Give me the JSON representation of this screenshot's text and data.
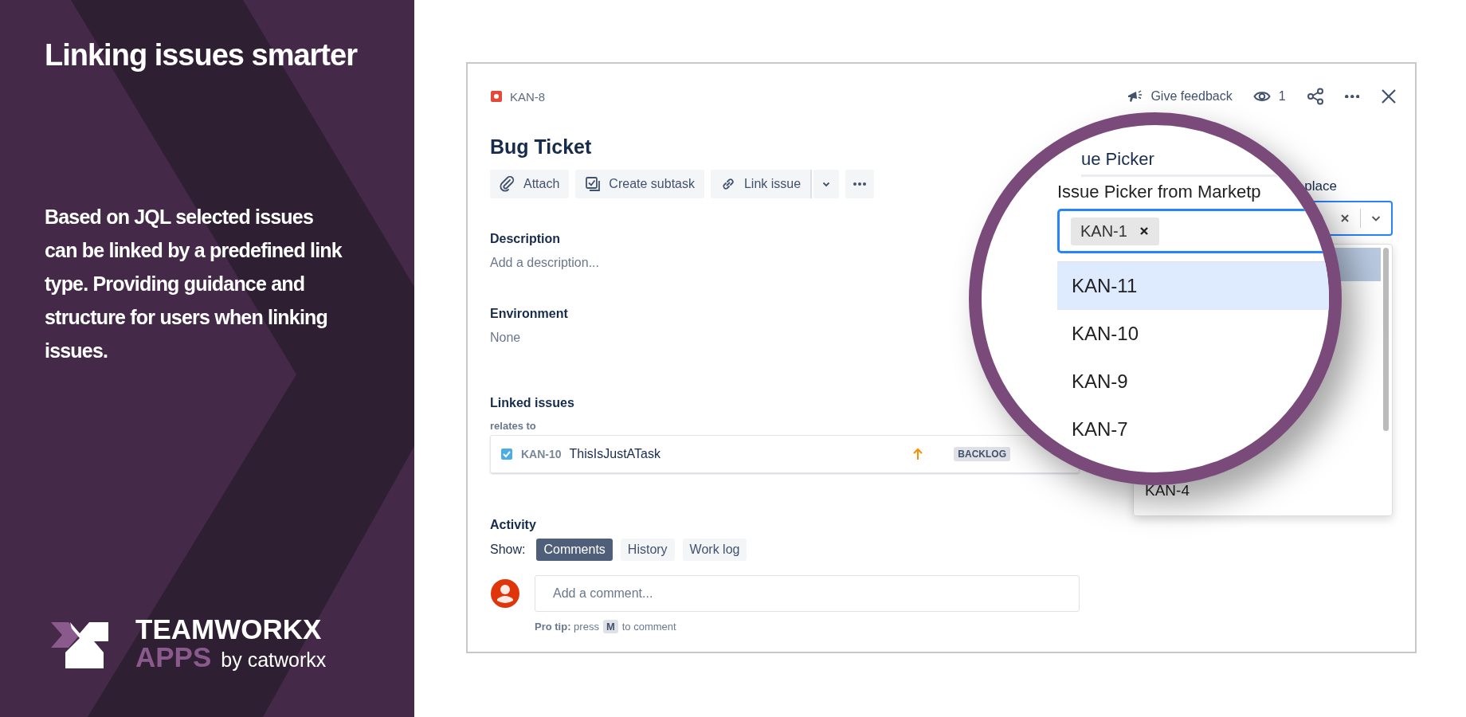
{
  "promo": {
    "title": "Linking issues smarter",
    "description": "Based on JQL selected issues can be linked by a predefined link type. Providing guidance and structure for users when linking issues.",
    "logo": {
      "brand": "TEAMWORKX",
      "apps": "APPS",
      "by": "by catworkx"
    }
  },
  "issue": {
    "key": "KAN-8",
    "header_actions": [
      {
        "kind": "feedback",
        "label": "Give feedback"
      },
      {
        "kind": "watch",
        "label": "1"
      },
      {
        "kind": "share"
      },
      {
        "kind": "more"
      },
      {
        "kind": "close"
      }
    ],
    "title": "Bug Ticket",
    "toolbar": [
      {
        "kind": "attach",
        "label": "Attach"
      },
      {
        "kind": "subtask",
        "label": "Create subtask"
      },
      {
        "kind": "link",
        "label": "Link issue"
      },
      {
        "kind": "dropdown"
      },
      {
        "kind": "more"
      }
    ],
    "fields": [
      {
        "label": "Description",
        "value": "Add a description..."
      },
      {
        "label": "Environment",
        "value": "None"
      }
    ],
    "linked_issues": {
      "title": "Linked issues",
      "relation": "relates to",
      "items": [
        {
          "key": "KAN-10",
          "summary": "ThisIsJustATask",
          "status": "BACKLOG"
        }
      ]
    },
    "activity": {
      "title": "Activity",
      "show_label": "Show:",
      "tabs": [
        {
          "label": "Comments",
          "selected": true
        },
        {
          "label": "History",
          "selected": false
        },
        {
          "label": "Work log",
          "selected": false
        }
      ],
      "comment_placeholder": "Add a comment...",
      "pro_tip": "**Pro tip:** press",
      "shortcut": "M",
      "pro_tip_end": "to comment"
    }
  },
  "picker": {
    "label": "place",
    "options": [
      "KAN-4"
    ]
  },
  "magnifier": {
    "heading": "ue Picker",
    "label": "Issue Picker from Marketp",
    "chip": "KAN-1",
    "options": [
      {
        "label": "KAN-11",
        "selected": true
      },
      {
        "label": "KAN-10",
        "selected": false
      },
      {
        "label": "KAN-9",
        "selected": false
      },
      {
        "label": "KAN-7",
        "selected": false
      }
    ]
  }
}
